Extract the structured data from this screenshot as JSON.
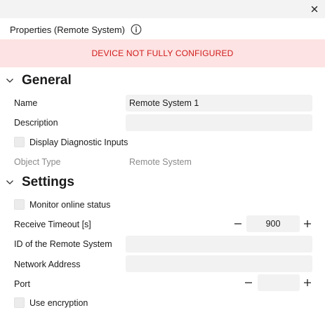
{
  "window": {
    "close_icon": "close-icon"
  },
  "header": {
    "title": "Properties (Remote System)",
    "info_icon": "info-icon"
  },
  "banner": {
    "text": "DEVICE NOT FULLY CONFIGURED",
    "background": "#fde3e3",
    "text_color": "#d11a1a"
  },
  "general": {
    "title": "General",
    "expanded": true,
    "name_label": "Name",
    "name_value": "Remote System 1",
    "description_label": "Description",
    "description_value": "",
    "display_diag_label": "Display Diagnostic Inputs",
    "display_diag_checked": false,
    "object_type_label": "Object Type",
    "object_type_value": "Remote System"
  },
  "settings": {
    "title": "Settings",
    "expanded": true,
    "monitor_label": "Monitor online status",
    "monitor_checked": false,
    "receive_timeout_label": "Receive Timeout [s]",
    "receive_timeout_value": "900",
    "remote_id_label": "ID of the Remote System",
    "remote_id_value": "",
    "network_address_label": "Network Address",
    "network_address_value": "",
    "port_label": "Port",
    "port_value": "",
    "encryption_label": "Use encryption",
    "encryption_checked": false
  }
}
